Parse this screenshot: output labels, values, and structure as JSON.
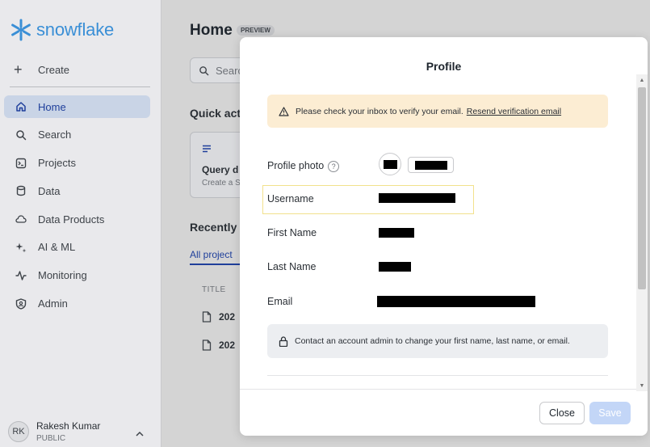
{
  "app": {
    "brand": "snowflake",
    "brand_color": "#3a8fd6"
  },
  "sidebar": {
    "create_label": "Create",
    "items": [
      {
        "label": "Home",
        "icon": "home-icon",
        "active": true
      },
      {
        "label": "Search",
        "icon": "search-icon",
        "active": false
      },
      {
        "label": "Projects",
        "icon": "terminal-icon",
        "active": false
      },
      {
        "label": "Data",
        "icon": "database-icon",
        "active": false
      },
      {
        "label": "Data Products",
        "icon": "cloud-icon",
        "active": false
      },
      {
        "label": "AI & ML",
        "icon": "sparkle-icon",
        "active": false
      },
      {
        "label": "Monitoring",
        "icon": "activity-icon",
        "active": false
      },
      {
        "label": "Admin",
        "icon": "shield-icon",
        "active": false
      }
    ],
    "user": {
      "initials": "RK",
      "name": "Rakesh Kumar",
      "role": "PUBLIC"
    }
  },
  "main": {
    "title": "Home",
    "badge": "PREVIEW",
    "search_placeholder": "Searc",
    "quick_actions_title": "Quick act",
    "quick_card": {
      "title": "Query d",
      "desc": "Create a S"
    },
    "recent_title": "Recently",
    "tab_label": "All project",
    "table_header": "TITLE",
    "rows": [
      "202",
      "202"
    ]
  },
  "modal": {
    "title": "Profile",
    "warning": {
      "text": "Please check your inbox to verify your email.",
      "link": "Resend verification email",
      "color": "#fcedd3"
    },
    "fields": {
      "photo_label": "Profile photo",
      "username_label": "Username",
      "first_name_label": "First Name",
      "last_name_label": "Last Name",
      "email_label": "Email"
    },
    "info_text": "Contact an account admin to change your first name, last name, or email.",
    "close_label": "Close",
    "save_label": "Save"
  }
}
